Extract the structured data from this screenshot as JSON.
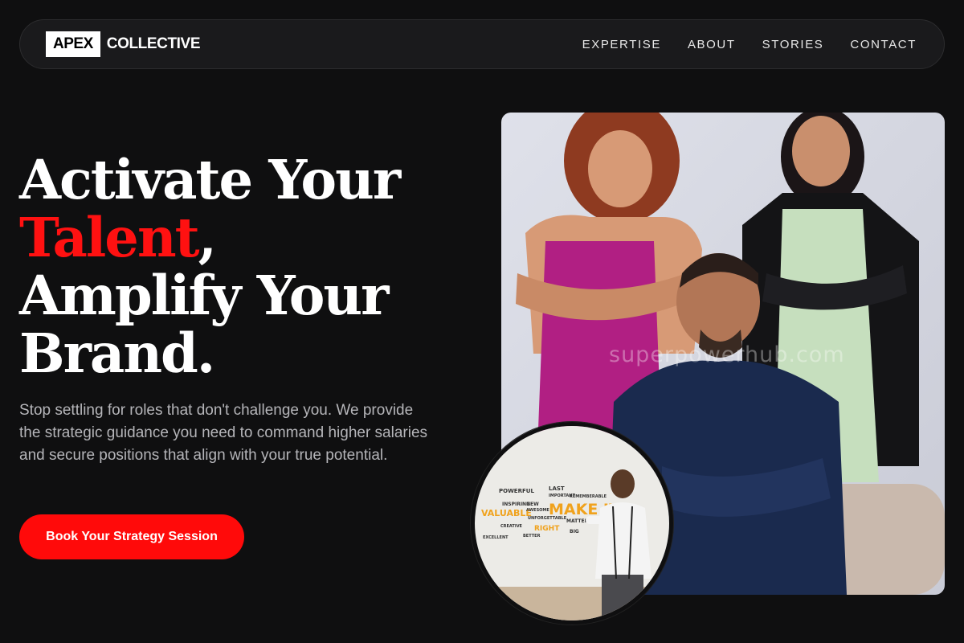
{
  "brand": {
    "box_text": "APEX",
    "word_text": "COLLECTIVE"
  },
  "nav": {
    "links": [
      "EXPERTISE",
      "ABOUT",
      "STORIES",
      "CONTACT"
    ]
  },
  "hero": {
    "headline_line1": "Activate Your",
    "headline_accent": "Talent",
    "headline_comma": ",",
    "headline_line3": "Amplify Your",
    "headline_line4": "Brand.",
    "subtext": "Stop settling for roles that don't challenge you. We provide the strategic guidance you need to command higher salaries and secure positions that align with your true potential.",
    "cta_label": "Book Your Strategy Session"
  },
  "main_image": {
    "watermark": "superpowerhub.com"
  },
  "inset_image": {
    "wall_words": [
      "POWERFUL",
      "VALUABLE",
      "INSPIRING",
      "MAKE IT",
      "RIGHT",
      "LAST",
      "NEW",
      "AWESOME",
      "BETTER",
      "EXCELLENT",
      "CREATIVE",
      "BIG",
      "MATTER",
      "IMPORTANT",
      "REMEMBERABLE",
      "UNFORGETTABLE"
    ]
  },
  "colors": {
    "background": "#0f0f10",
    "accent_red": "#ff0a0a",
    "nav_bg": "#1a1a1c",
    "text_muted": "#b5b5b9"
  }
}
